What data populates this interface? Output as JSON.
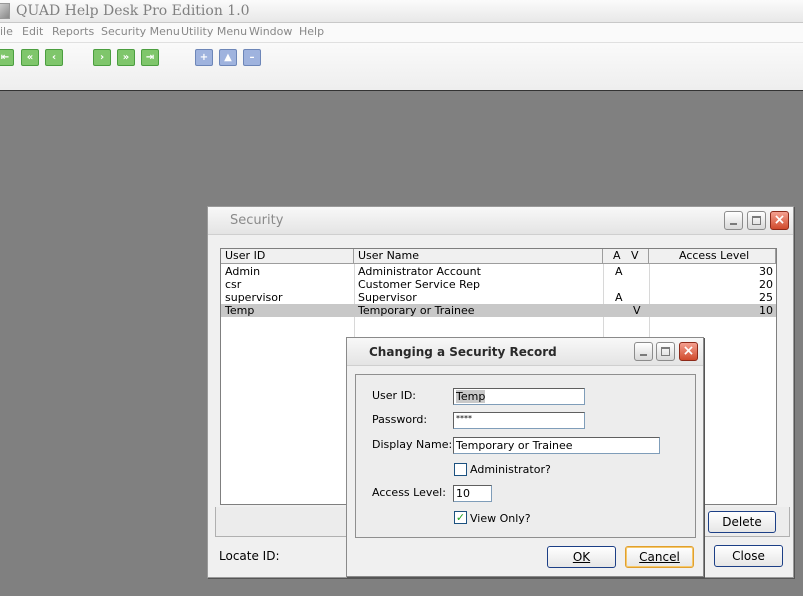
{
  "app": {
    "title": "QUAD Help Desk Pro Edition 1.0",
    "menu": [
      "ile",
      "Edit",
      "Reports",
      "Security Menu",
      "Utility Menu",
      "Window",
      "Help"
    ]
  },
  "toolbar": {
    "first": "⇤",
    "prev_page": "«",
    "prev": "‹",
    "next": "›",
    "next_page": "»",
    "last": "⇥",
    "add": "+",
    "up": "▲",
    "remove": "–"
  },
  "security_window": {
    "title": "Security",
    "columns": {
      "user_id": "User ID",
      "user_name": "User Name",
      "av": "A   V",
      "access_level": "Access Level"
    },
    "rows": [
      {
        "user_id": "Admin",
        "user_name": "Administrator Account",
        "a": "A",
        "v": "",
        "level": "30"
      },
      {
        "user_id": "csr",
        "user_name": "Customer Service Rep",
        "a": "",
        "v": "",
        "level": "20"
      },
      {
        "user_id": "supervisor",
        "user_name": "Supervisor",
        "a": "A",
        "v": "",
        "level": "25"
      },
      {
        "user_id": "Temp",
        "user_name": "Temporary or Trainee",
        "a": "",
        "v": "V",
        "level": "10"
      }
    ],
    "locate_label": "Locate ID:",
    "delete_label": "Delete",
    "close_label": "Close"
  },
  "dialog": {
    "title": "Changing a Security Record",
    "user_id_label": "User ID:",
    "user_id_value": "Temp",
    "password_label": "Password:",
    "password_value": "****",
    "display_name_label": "Display Name:",
    "display_name_value": "Temporary or Trainee",
    "administrator_label": "Administrator?",
    "administrator_checked": false,
    "access_level_label": "Access Level:",
    "access_level_value": "10",
    "view_only_label": "View Only?",
    "view_only_checked": true,
    "check_mark": "✓",
    "ok_label": "OK",
    "cancel_label": "Cancel"
  },
  "colors": {
    "desktop": "#808080",
    "close_button": "#d04a2c",
    "toolbar_green": "#7fc66b",
    "toolbar_blue": "#9fb3de"
  },
  "icons": [
    "app-icon",
    "first-record-icon",
    "previous-page-icon",
    "previous-record-icon",
    "next-record-icon",
    "next-page-icon",
    "last-record-icon",
    "add-record-icon",
    "up-icon",
    "remove-record-icon",
    "minimize-icon",
    "maximize-icon",
    "close-icon"
  ]
}
